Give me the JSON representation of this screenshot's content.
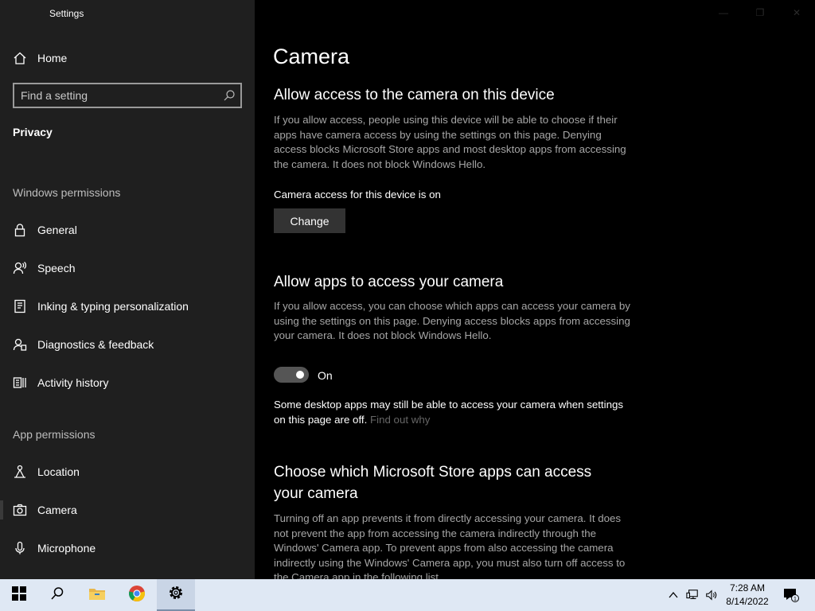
{
  "window": {
    "title": "Settings"
  },
  "sidebar": {
    "home_label": "Home",
    "search": {
      "placeholder": "Find a setting"
    },
    "section_title": "Privacy",
    "windows_permissions_heading": "Windows permissions",
    "windows_items": [
      {
        "label": "General",
        "icon": "lock-icon"
      },
      {
        "label": "Speech",
        "icon": "speech-icon"
      },
      {
        "label": "Inking & typing personalization",
        "icon": "inking-icon"
      },
      {
        "label": "Diagnostics & feedback",
        "icon": "diagnostics-icon"
      },
      {
        "label": "Activity history",
        "icon": "activity-icon"
      }
    ],
    "app_permissions_heading": "App permissions",
    "app_items": [
      {
        "label": "Location",
        "icon": "location-icon"
      },
      {
        "label": "Camera",
        "icon": "camera-icon",
        "selected": true
      },
      {
        "label": "Microphone",
        "icon": "microphone-icon"
      }
    ]
  },
  "main": {
    "page_title": "Camera",
    "device_section": {
      "title": "Allow access to the camera on this device",
      "description": "If you allow access, people using this device will be able to choose if their apps have camera access by using the settings on this page. Denying access blocks Microsoft Store apps and most desktop apps from accessing the camera. It does not block Windows Hello.",
      "status": "Camera access for this device is on",
      "change_label": "Change"
    },
    "apps_section": {
      "title": "Allow apps to access your camera",
      "description": "If you allow access, you can choose which apps can access your camera by using the settings on this page. Denying access blocks apps from accessing your camera. It does not block Windows Hello.",
      "toggle_state": "On",
      "note": "Some desktop apps may still be able to access your camera when settings on this page are off.",
      "note_link": "Find out why"
    },
    "store_section": {
      "title": "Choose which Microsoft Store apps can access your camera",
      "description": "Turning off an app prevents it from directly accessing your camera. It does not prevent the app from accessing the camera indirectly through the Windows' Camera app. To prevent apps from also accessing the camera indirectly using the Windows' Camera app, you must also turn off access to the Camera app in the following list."
    }
  },
  "taskbar": {
    "time": "7:28 AM",
    "date": "8/14/2022",
    "notification_count": "1",
    "accent": "#dfe8f4"
  }
}
